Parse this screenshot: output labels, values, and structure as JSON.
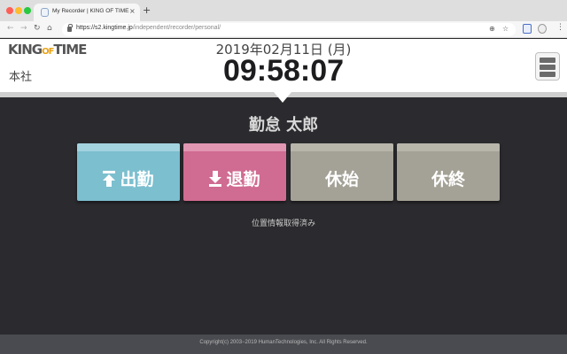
{
  "browser": {
    "tab_title": "My Recorder | KING OF TIME",
    "tab_close": "×",
    "new_tab": "+",
    "url_host": "https://s2.kingtime.jp",
    "url_path": "/independent/recorder/personal/",
    "nav": {
      "back": "←",
      "forward": "→",
      "reload": "↻",
      "home": "⌂"
    },
    "omni_icons": {
      "key": "⊕",
      "star": "☆"
    },
    "menu": "⋮"
  },
  "header": {
    "logo": {
      "part1": "KING",
      "part2": "OF",
      "part3": "TIME"
    },
    "branch": "本社",
    "date": "2019年02月11日 (月)",
    "clock": "09:58:07"
  },
  "main": {
    "employee_name": "勤怠 太郎",
    "buttons": [
      {
        "label": "出勤",
        "icon": "arrow-up-icon",
        "color": "#7cbfcf"
      },
      {
        "label": "退勤",
        "icon": "arrow-down-icon",
        "color": "#d06b91"
      },
      {
        "label": "休始",
        "color": "#a4a196"
      },
      {
        "label": "休終",
        "color": "#a4a196"
      }
    ],
    "geo_status": "位置情報取得済み"
  },
  "footer": {
    "copyright": "Copyright(c) 2003−2019 HumanTechnologies, Inc. All Rights Reserved."
  },
  "colors": {
    "background": "#2b2b2f",
    "header": "#ffffff",
    "footer": "#4a4b50",
    "logo_accent": "#e8a316"
  }
}
